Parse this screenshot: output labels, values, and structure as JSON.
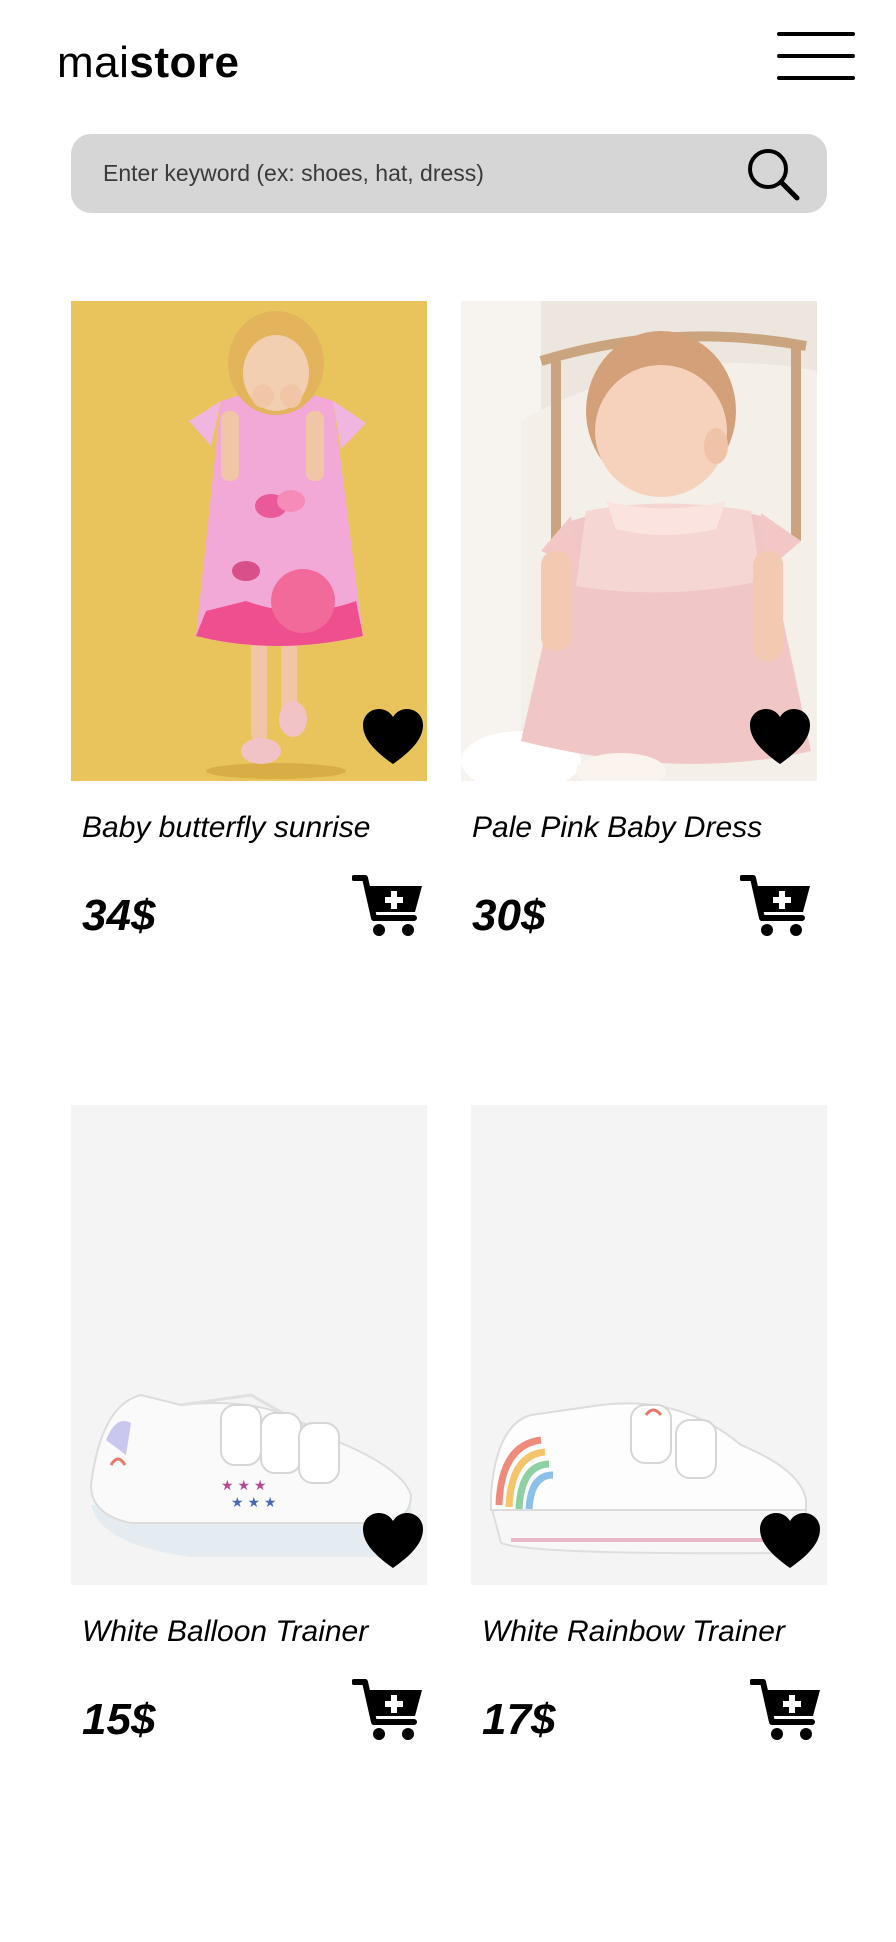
{
  "brand": {
    "light": "mai",
    "bold": "store"
  },
  "search": {
    "placeholder": "Enter keyword (ex: shoes, hat, dress)"
  },
  "products": [
    {
      "name": "Baby butterfly sunrise",
      "price": "34$",
      "image": "girl-in-pink-butterfly-dress-photo",
      "background": "#e7c25a"
    },
    {
      "name": "Pale Pink Baby Dress",
      "price": "30$",
      "image": "baby-in-pale-pink-dress-photo",
      "background": "#efe3da"
    },
    {
      "name": "White Balloon Trainer",
      "price": "15$",
      "image": "white-star-trainer-photo",
      "background": "#f4f4f4"
    },
    {
      "name": "White Rainbow Trainer",
      "price": "17$",
      "image": "white-rainbow-trainer-photo",
      "background": "#f4f4f4"
    }
  ],
  "icons": {
    "menu": "hamburger-menu-icon",
    "search": "search-icon",
    "favorite": "heart-icon",
    "cart": "add-to-cart-icon"
  }
}
